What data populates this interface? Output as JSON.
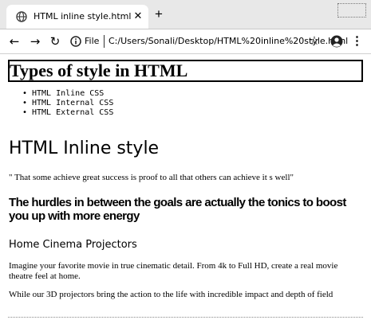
{
  "browser": {
    "tab": {
      "title": "HTML inline style.html",
      "favicon": "globe-icon",
      "close_icon": "close-icon"
    },
    "new_tab_icon": "plus-icon",
    "toolbar": {
      "back_icon": "back-arrow-icon",
      "forward_icon": "forward-arrow-icon",
      "reload_icon": "reload-icon",
      "info_icon": "info-icon",
      "scheme_label": "File",
      "url": "C:/Users/Sonali/Desktop/HTML%20inline%20style.html",
      "bookmark_icon": "star-icon",
      "profile_icon": "profile-icon",
      "menu_icon": "kebab-menu-icon"
    }
  },
  "page": {
    "title": "Types of style in HTML",
    "style_list": [
      "HTML Inline CSS",
      "HTML Internal CSS",
      "HTML External CSS"
    ],
    "inline_heading": "HTML Inline style",
    "quote": "\" That some achieve great success is proof to all that others can achieve it s well\"",
    "hurdles_heading": "The hurdles in between the goals are actually the tonics to boost you up with more energy",
    "projectors_heading": "Home Cinema Projectors",
    "paragraph_1": "Imagine your favorite movie in true cinematic detail. From 4k to Full HD, create a real movie theatre feel at home.",
    "paragraph_2": "While our 3D projectors bring the action to the life with incredible impact and depth of field"
  }
}
